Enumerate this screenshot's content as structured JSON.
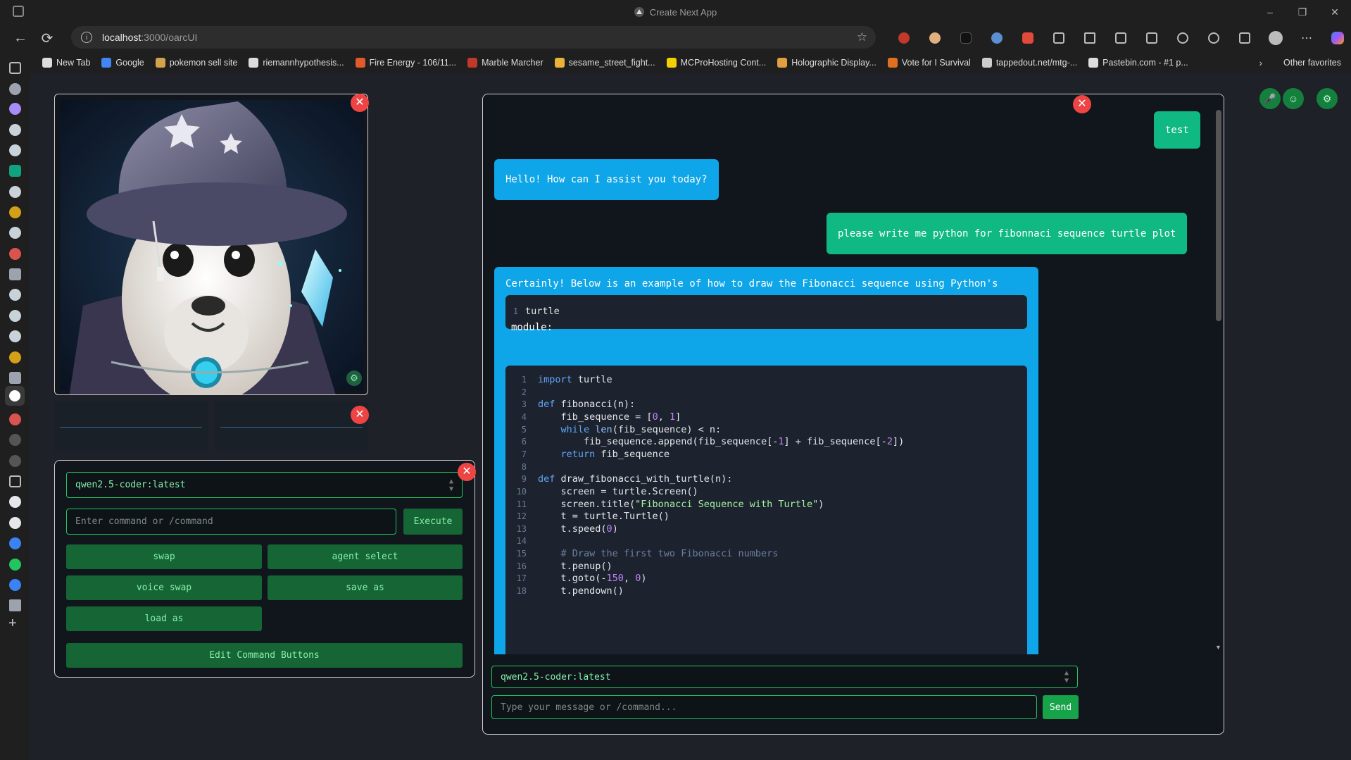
{
  "browser": {
    "window_title": "Create Next App",
    "url_host": "localhost",
    "url_path": ":3000/oarcUI",
    "bookmarks": [
      {
        "label": "New Tab",
        "color": "#dddddd"
      },
      {
        "label": "Google",
        "color": "#4285f4"
      },
      {
        "label": "pokemon sell site",
        "color": "#d4a24c"
      },
      {
        "label": "riemannhypothesis...",
        "color": "#dddddd"
      },
      {
        "label": "Fire Energy - 106/11...",
        "color": "#e05a2a"
      },
      {
        "label": "Marble Marcher",
        "color": "#c0392b"
      },
      {
        "label": "sesame_street_fight...",
        "color": "#e8b339"
      },
      {
        "label": "MCProHosting Cont...",
        "color": "#f5d000"
      },
      {
        "label": "Holographic Display...",
        "color": "#e0a040"
      },
      {
        "label": "Vote for I Survival",
        "color": "#e07020"
      },
      {
        "label": "tappedout.net/mtg-...",
        "color": "#cccccc"
      },
      {
        "label": "Pastebin.com - #1 p...",
        "color": "#dddddd"
      }
    ],
    "other_favorites": "Other favorites"
  },
  "command_panel": {
    "model_select": "qwen2.5-coder:latest",
    "command_placeholder": "Enter command or /command",
    "execute_label": "Execute",
    "buttons": {
      "swap": "swap",
      "agent_select": "agent select",
      "voice_swap": "voice swap",
      "save_as": "save as",
      "load_as": "load as",
      "edit": "Edit Command Buttons"
    }
  },
  "chat": {
    "messages": {
      "m1": "test",
      "m2": "Hello! How can I assist you today?",
      "m3": "please write me python for fibonnaci sequence turtle plot",
      "m4_intro": "Certainly! Below is an example of how to draw the Fibonacci sequence using Python's",
      "m4_inline_code": "turtle",
      "m4_after": "module:"
    },
    "code_lines": [
      "import turtle",
      "",
      "def fibonacci(n):",
      "    fib_sequence = [0, 1]",
      "    while len(fib_sequence) < n:",
      "        fib_sequence.append(fib_sequence[-1] + fib_sequence[-2])",
      "    return fib_sequence",
      "",
      "def draw_fibonacci_with_turtle(n):",
      "    screen = turtle.Screen()",
      "    screen.title(\"Fibonacci Sequence with Turtle\")",
      "    t = turtle.Turtle()",
      "    t.speed(0)",
      "",
      "    # Draw the first two Fibonacci numbers",
      "    t.penup()",
      "    t.goto(-150, 0)",
      "    t.pendown()"
    ],
    "model_select": "qwen2.5-coder:latest",
    "message_placeholder": "Type your message or /command...",
    "send_label": "Send"
  }
}
